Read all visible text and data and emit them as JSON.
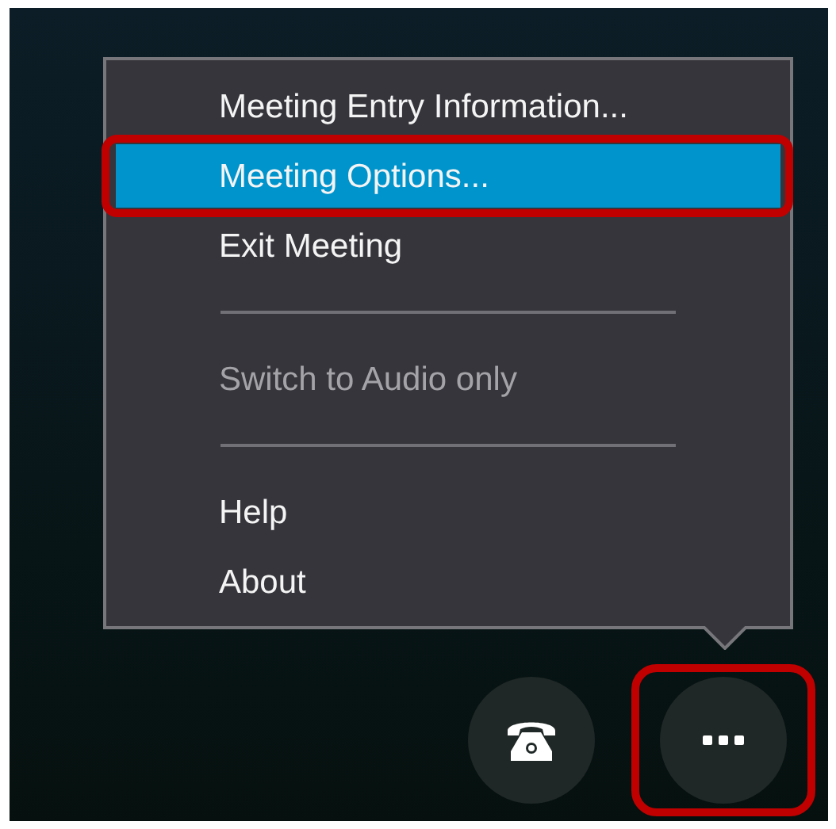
{
  "menu": {
    "items": [
      {
        "kind": "item",
        "label": "Meeting Entry Information...",
        "selected": false,
        "disabled": false,
        "annotated": false
      },
      {
        "kind": "item",
        "label": "Meeting Options...",
        "selected": true,
        "disabled": false,
        "annotated": true
      },
      {
        "kind": "item",
        "label": "Exit Meeting",
        "selected": false,
        "disabled": false,
        "annotated": false
      },
      {
        "kind": "separator"
      },
      {
        "kind": "item",
        "label": "Switch to Audio only",
        "selected": false,
        "disabled": true,
        "annotated": false
      },
      {
        "kind": "separator"
      },
      {
        "kind": "item",
        "label": "Help",
        "selected": false,
        "disabled": false,
        "annotated": false
      },
      {
        "kind": "item",
        "label": "About",
        "selected": false,
        "disabled": false,
        "annotated": false
      }
    ]
  },
  "controls": [
    {
      "kind": "phone",
      "annotated": false
    },
    {
      "kind": "more",
      "annotated": true
    }
  ]
}
